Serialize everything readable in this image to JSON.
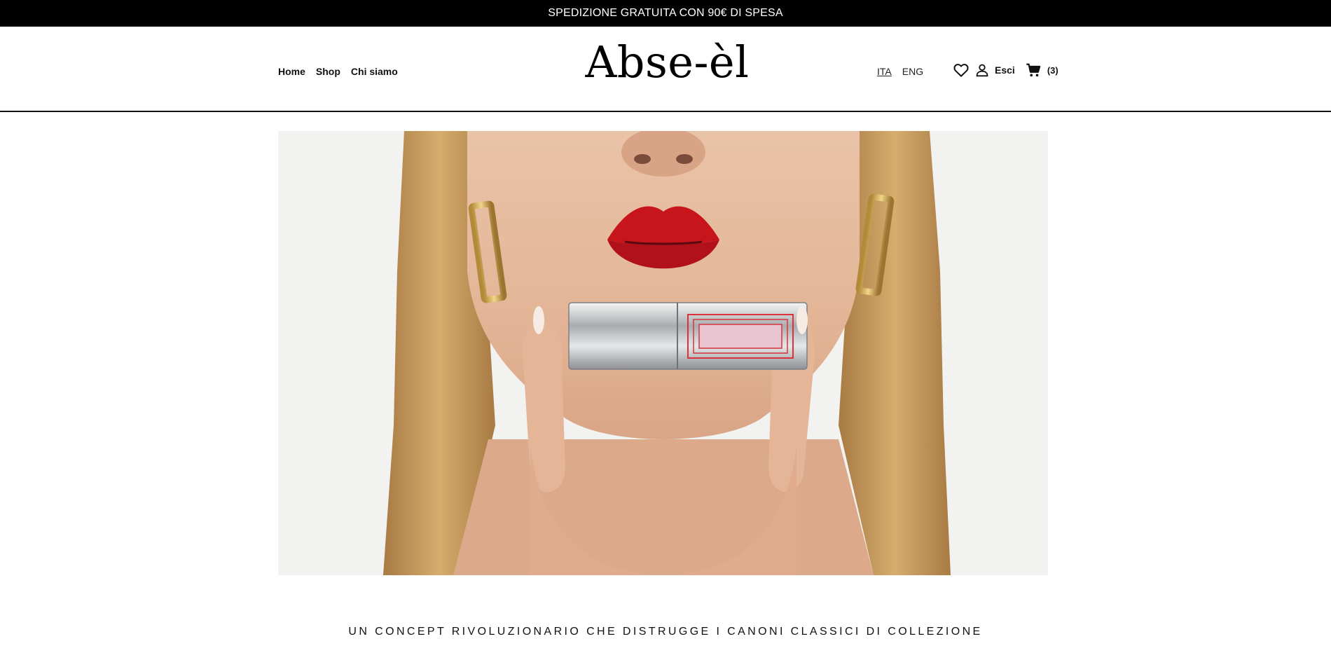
{
  "promo_bar": {
    "text": "SPEDIZIONE GRATUITA CON 90€ DI SPESA"
  },
  "header": {
    "nav": [
      {
        "label": "Home"
      },
      {
        "label": "Shop"
      },
      {
        "label": "Chi siamo"
      }
    ],
    "logo": "Abse-èl",
    "languages": [
      {
        "label": "ITA",
        "active": true
      },
      {
        "label": "ENG",
        "active": false
      }
    ],
    "tools": {
      "wishlist_icon": "heart-icon",
      "account_icon": "user-icon",
      "logout_label": "Esci",
      "cart_icon": "cart-icon",
      "cart_count": "(3)"
    }
  },
  "hero": {
    "image": "woman with red lips holding silver lipstick case"
  },
  "tagline": "UN CONCEPT RIVOLUZIONARIO CHE DISTRUGGE I CANONI CLASSICI DI COLLEZIONE",
  "colors": {
    "promo_bg": "#000000",
    "text": "#111111",
    "lip_red": "#c8141b",
    "hair": "#c79a5a",
    "skin": "#e8bfa3"
  }
}
